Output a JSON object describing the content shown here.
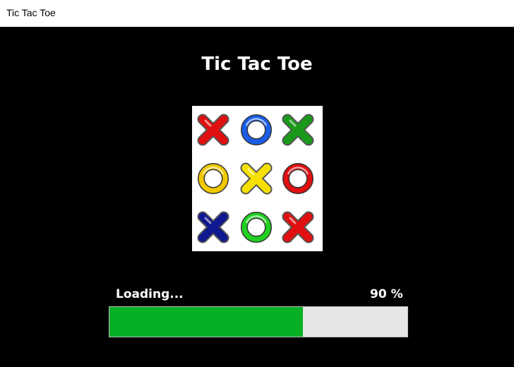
{
  "window": {
    "title": "Tic Tac Toe"
  },
  "app": {
    "title": "Tic Tac Toe"
  },
  "logo": {
    "cells": [
      {
        "symbol": "X",
        "color": "#e01010"
      },
      {
        "symbol": "O",
        "color": "#1a5ee8"
      },
      {
        "symbol": "X",
        "color": "#1a9a1a"
      },
      {
        "symbol": "O",
        "color": "#f0c800"
      },
      {
        "symbol": "X",
        "color": "#f5e000"
      },
      {
        "symbol": "O",
        "color": "#e01010"
      },
      {
        "symbol": "X",
        "color": "#101890"
      },
      {
        "symbol": "O",
        "color": "#20d020"
      },
      {
        "symbol": "X",
        "color": "#e01010"
      }
    ]
  },
  "loading": {
    "label": "Loading...",
    "percent_text": "90 %",
    "progress_fraction": 0.65,
    "fill_color": "#06b025",
    "track_color": "#e6e6e6"
  }
}
